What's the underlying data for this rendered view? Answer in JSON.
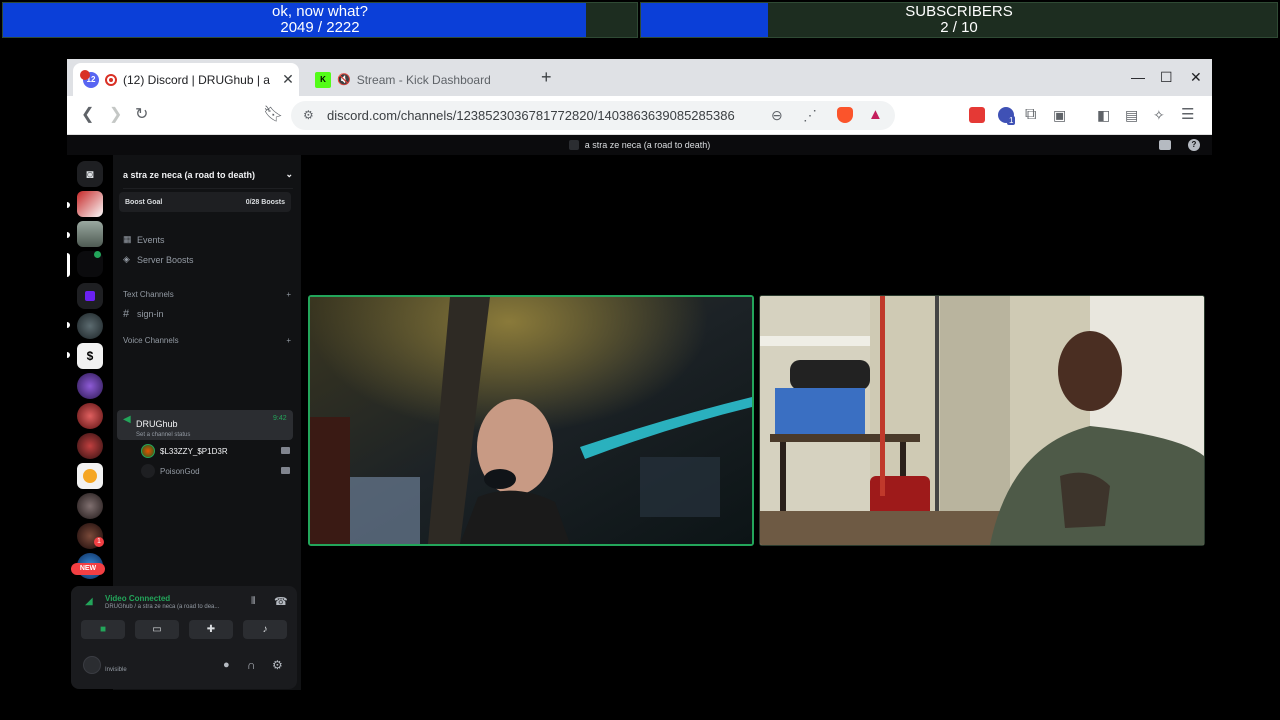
{
  "goals": [
    {
      "title": "ok, now what?",
      "current": "2049",
      "target": "2222",
      "progress": 0.92
    },
    {
      "title": "SUBSCRIBERS",
      "current": "2",
      "target": "10",
      "progress": 0.2
    }
  ],
  "browser": {
    "tabs": [
      {
        "badge": "12",
        "title": "(12) Discord | DRUGhub | a"
      },
      {
        "title": "Stream - Kick Dashboard"
      }
    ],
    "new_tab_label": "+",
    "url": "discord.com/channels/1238523036781772820/1403863639085285386",
    "extension_badge": "1"
  },
  "discord": {
    "window_title": "a stra ze neca (a road to death)",
    "server_name": "a stra ze neca (a road to death)",
    "boost_goal": {
      "label": "Boost Goal",
      "count": "0/28 Boosts"
    },
    "menu": [
      "Events",
      "Server Boosts"
    ],
    "text_category": "Text Channels",
    "text_channels": [
      "sign-in"
    ],
    "voice_category": "Voice Channels",
    "voice_channel": {
      "name": "DRUGhub",
      "status": "Set a channel status",
      "time": "9:42"
    },
    "voice_users": [
      {
        "name": "$L33ZZY_$P1D3R",
        "color": "#f2f3f5"
      },
      {
        "name": "PoisonGod",
        "color": "#949ba4"
      }
    ],
    "server_badges": {
      "mention": "1",
      "new": "NEW"
    },
    "voice_panel": {
      "status": "Video Connected",
      "subtitle": "DRUGhub / a stra ze neca (a road to dea...",
      "user_name": "",
      "user_state": "Invisible"
    }
  },
  "colors": {
    "goal_fill": "#0b3fd8",
    "discord_green": "#23a55a",
    "kick_green": "#53fc18",
    "blurple": "#5865f2"
  }
}
